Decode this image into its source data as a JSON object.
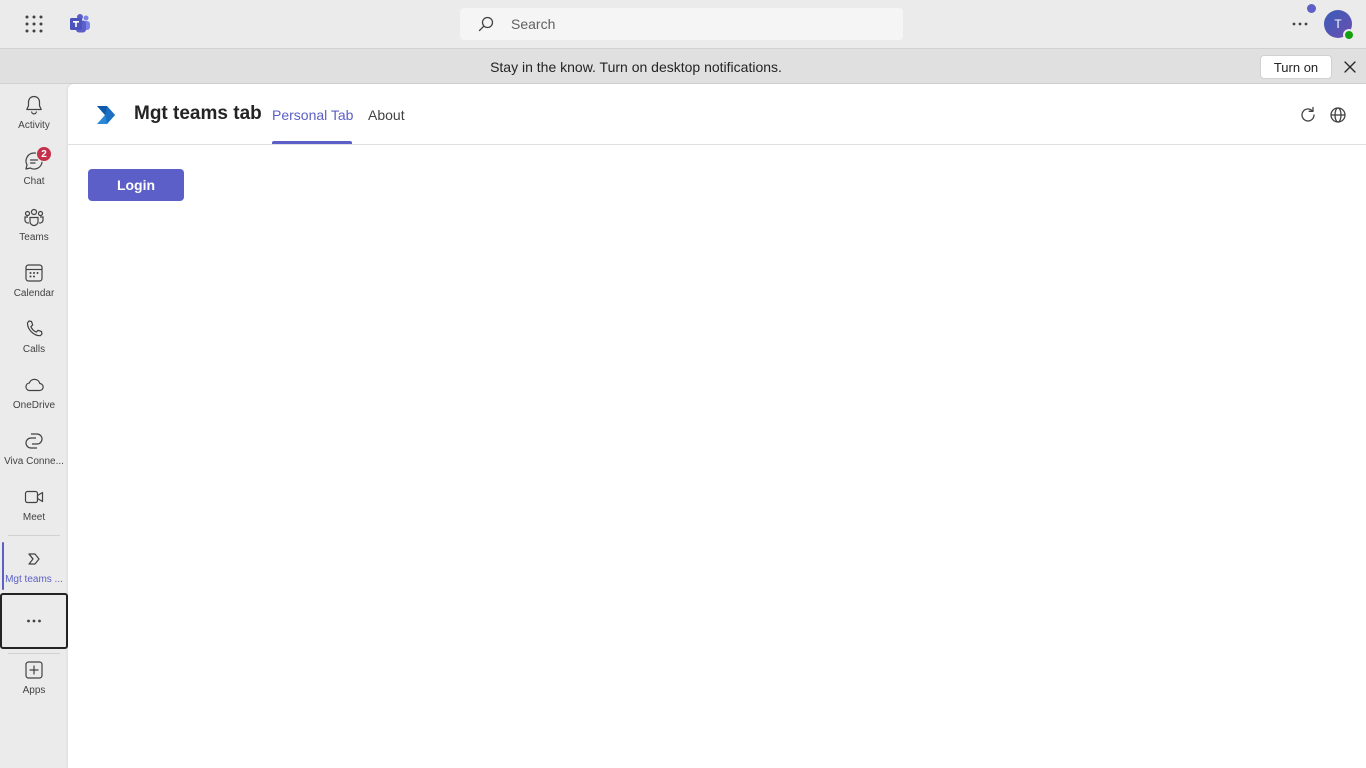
{
  "topbar": {
    "search_placeholder": "Search",
    "avatar_initial": "T"
  },
  "banner": {
    "message": "Stay in the know. Turn on desktop notifications.",
    "turn_on_label": "Turn on"
  },
  "rail": {
    "items": [
      {
        "label": "Activity",
        "icon": "bell-icon"
      },
      {
        "label": "Chat",
        "icon": "chat-icon",
        "badge": "2"
      },
      {
        "label": "Teams",
        "icon": "teams-icon"
      },
      {
        "label": "Calendar",
        "icon": "calendar-icon"
      },
      {
        "label": "Calls",
        "icon": "phone-icon"
      },
      {
        "label": "OneDrive",
        "icon": "cloud-icon"
      },
      {
        "label": "Viva Conne...",
        "icon": "viva-icon"
      },
      {
        "label": "Meet",
        "icon": "video-icon"
      },
      {
        "label": "Mgt teams ...",
        "icon": "app-icon"
      },
      {
        "label": "Apps",
        "icon": "add-app-icon"
      }
    ]
  },
  "app": {
    "title": "Mgt teams tab",
    "tabs": [
      {
        "label": "Personal Tab",
        "active": true
      },
      {
        "label": "About",
        "active": false
      }
    ],
    "login_label": "Login"
  },
  "colors": {
    "brand": "#5b5fc7",
    "badge": "#c4314b",
    "status_available": "#13a10e"
  }
}
